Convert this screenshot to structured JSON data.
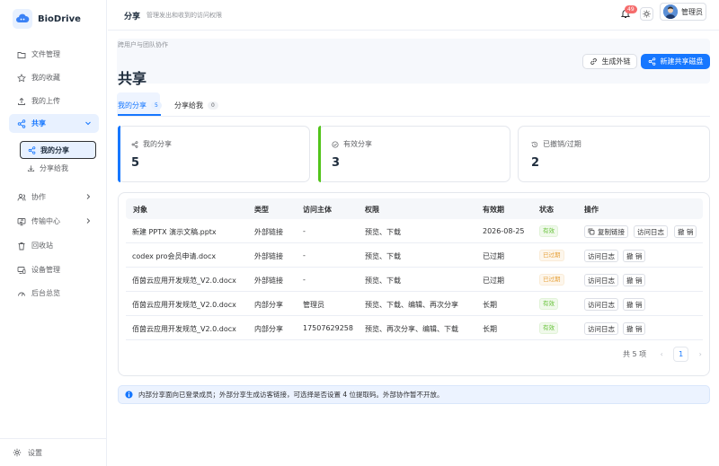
{
  "app": {
    "name": "BioDrive"
  },
  "sidebar": {
    "items": [
      {
        "label": "文件管理",
        "icon": "folder-icon"
      },
      {
        "label": "我的收藏",
        "icon": "star-icon"
      },
      {
        "label": "我的上传",
        "icon": "upload-icon"
      },
      {
        "label": "共享",
        "icon": "share-icon"
      },
      {
        "label": "协作",
        "icon": "users-icon"
      },
      {
        "label": "传输中心",
        "icon": "transfer-icon"
      },
      {
        "label": "回收站",
        "icon": "trash-icon"
      },
      {
        "label": "设备管理",
        "icon": "device-icon"
      },
      {
        "label": "后台总览",
        "icon": "dashboard-icon"
      }
    ],
    "share_children": [
      {
        "label": "我的分享",
        "icon": "share-icon"
      },
      {
        "label": "分享给我",
        "icon": "download-icon"
      }
    ],
    "settings_label": "设置"
  },
  "header": {
    "title": "分享",
    "subtitle": "管理发出和收到的访问权限",
    "notification_count": "49",
    "user_name": "管理员"
  },
  "page": {
    "breadcrumb": "跨用户与团队协作",
    "title": "共享",
    "btn_link": "生成外链",
    "btn_new": "新建共享磁盘"
  },
  "tabs": [
    {
      "label": "我的分享",
      "count": "5"
    },
    {
      "label": "分享给我",
      "count": "0"
    }
  ],
  "stats": [
    {
      "label": "我的分享",
      "value": "5",
      "color": "#1677ff"
    },
    {
      "label": "有效分享",
      "value": "3",
      "color": "#52c41a"
    },
    {
      "label": "已撤销/过期",
      "value": "2",
      "color": "#c0c4cc"
    }
  ],
  "table": {
    "headers": [
      "对象",
      "类型",
      "访问主体",
      "权限",
      "有效期",
      "状态",
      "操作"
    ],
    "rows": [
      {
        "object": "新建 PPTX 演示文稿.pptx",
        "type": "外部链接",
        "subject": "-",
        "perm": "预览、下载",
        "expiry": "2026-08-25",
        "status": "有效"
      },
      {
        "object": "codex pro会员申请.docx",
        "type": "外部链接",
        "subject": "-",
        "perm": "预览、下载",
        "expiry": "已过期",
        "status": "已过期"
      },
      {
        "object": "佰茵云应用开发规范_V2.0.docx",
        "type": "外部链接",
        "subject": "-",
        "perm": "预览、下载",
        "expiry": "已过期",
        "status": "已过期"
      },
      {
        "object": "佰茵云应用开发规范_V2.0.docx",
        "type": "内部分享",
        "subject": "管理员",
        "perm": "预览、下载、编辑、再次分享",
        "expiry": "长期",
        "status": "有效"
      },
      {
        "object": "佰茵云应用开发规范_V2.0.docx",
        "type": "内部分享",
        "subject": "17507629258",
        "perm": "预览、再次分享、编辑、下载",
        "expiry": "长期",
        "status": "有效"
      }
    ],
    "actions": {
      "copy": "复制链接",
      "log": "访问日志",
      "revoke": "撤 销"
    }
  },
  "pagination": {
    "total": "共 5 项",
    "page": "1"
  },
  "info": "内部分享面向已登录成员；外部分享生成访客链接，可选择是否设置 4 位提取码。外部协作暂不开放。"
}
